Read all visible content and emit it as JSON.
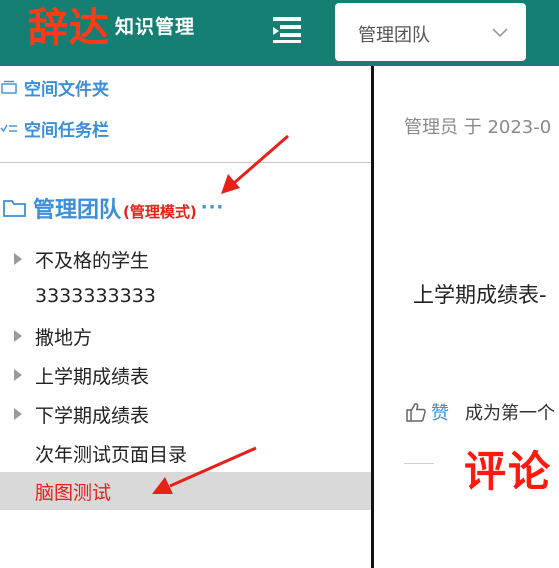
{
  "header": {
    "logo_main": "辞达",
    "logo_sub": "知识管理",
    "team_select": {
      "value": "管理团队"
    }
  },
  "sidebar": {
    "links": [
      {
        "label": "空间文件夹"
      },
      {
        "label": "空间任务栏"
      }
    ],
    "team": {
      "name": "管理团队",
      "mode": "(管理模式)",
      "more": "···"
    },
    "tree": [
      {
        "label": "不及格的学生",
        "expandable": true,
        "active": false
      },
      {
        "label": "3333333333",
        "expandable": false,
        "active": false
      },
      {
        "label": "撒地方",
        "expandable": true,
        "active": false
      },
      {
        "label": "上学期成绩表",
        "expandable": true,
        "active": false
      },
      {
        "label": "下学期成绩表",
        "expandable": true,
        "active": false
      },
      {
        "label": "次年测试页面目录",
        "expandable": false,
        "active": false
      },
      {
        "label": "脑图测试",
        "expandable": false,
        "active": true
      }
    ]
  },
  "main": {
    "meta": "管理员 于 2023-0",
    "doc_title": "上学期成绩表-",
    "like_label": "赞",
    "first_comment_text": "成为第一个",
    "comment_heading": "评论"
  },
  "colors": {
    "header_bg": "#167f73",
    "logo_red": "#ff3a1a",
    "link_blue": "#3b8fd9",
    "alert_red": "#e8201a",
    "active_bg": "#d9d9d9"
  }
}
